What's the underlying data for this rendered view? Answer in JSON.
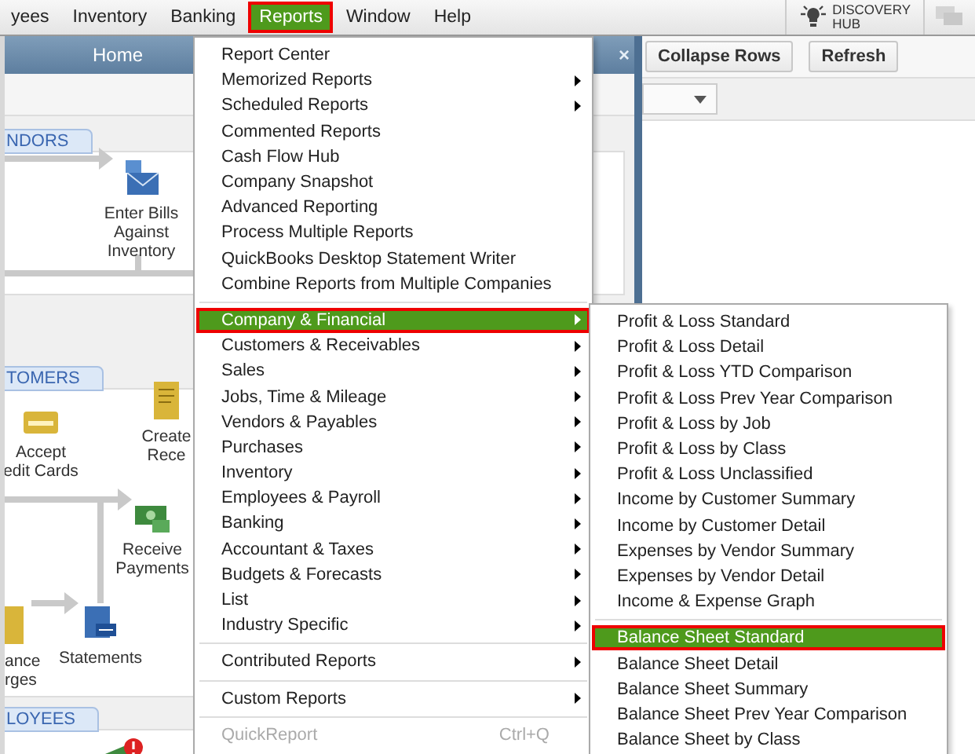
{
  "menubar": {
    "items": [
      {
        "label": "yees",
        "selected": false
      },
      {
        "label": "Inventory",
        "selected": false
      },
      {
        "label": "Banking",
        "selected": false
      },
      {
        "label": "Reports",
        "selected": true
      },
      {
        "label": "Window",
        "selected": false
      },
      {
        "label": "Help",
        "selected": false
      }
    ],
    "discovery_hub": {
      "line1": "DISCOVERY",
      "line2": "HUB"
    }
  },
  "home_window": {
    "title": "Home",
    "close": "×",
    "sections": [
      {
        "label": "NDORS"
      },
      {
        "label": "TOMERS"
      },
      {
        "label": "LOYEES"
      }
    ],
    "nodes": [
      {
        "lines": [
          "Enter Bills",
          "Against",
          "Inventory"
        ],
        "kind": "bills"
      },
      {
        "lines": [
          "Accept",
          "edit Cards"
        ],
        "kind": "card"
      },
      {
        "lines": [
          "Create",
          "Rece"
        ],
        "kind": "receipt"
      },
      {
        "lines": [
          "Receive",
          "Payments"
        ],
        "kind": "payment"
      },
      {
        "lines": [
          "ance",
          "rges"
        ],
        "kind": "charges"
      },
      {
        "lines": [
          "Statements"
        ],
        "kind": "statement"
      },
      {
        "kind": "paycheck"
      }
    ]
  },
  "report_toolbar": {
    "buttons": [
      "Collapse Rows",
      "Refresh"
    ]
  },
  "reports_menu": {
    "items": [
      {
        "label": "Report Center",
        "submenu": false,
        "selected": false,
        "disabled": false,
        "separator_before": false
      },
      {
        "label": "Memorized Reports",
        "submenu": true,
        "selected": false,
        "disabled": false,
        "separator_before": false
      },
      {
        "label": "Scheduled Reports",
        "submenu": true,
        "selected": false,
        "disabled": false,
        "separator_before": false
      },
      {
        "label": "Commented Reports",
        "submenu": false,
        "selected": false,
        "disabled": false,
        "separator_before": false
      },
      {
        "label": "Cash Flow Hub",
        "submenu": false,
        "selected": false,
        "disabled": false,
        "separator_before": false
      },
      {
        "label": "Company Snapshot",
        "submenu": false,
        "selected": false,
        "disabled": false,
        "separator_before": false
      },
      {
        "label": "Advanced Reporting",
        "submenu": false,
        "selected": false,
        "disabled": false,
        "separator_before": false
      },
      {
        "label": "Process Multiple Reports",
        "submenu": false,
        "selected": false,
        "disabled": false,
        "separator_before": false
      },
      {
        "label": "QuickBooks Desktop Statement Writer",
        "submenu": false,
        "selected": false,
        "disabled": false,
        "separator_before": false
      },
      {
        "label": "Combine Reports from Multiple Companies",
        "submenu": false,
        "selected": false,
        "disabled": false,
        "separator_before": false
      },
      {
        "label": "Company & Financial",
        "submenu": true,
        "selected": true,
        "disabled": false,
        "separator_before": true
      },
      {
        "label": "Customers & Receivables",
        "submenu": true,
        "selected": false,
        "disabled": false,
        "separator_before": false
      },
      {
        "label": "Sales",
        "submenu": true,
        "selected": false,
        "disabled": false,
        "separator_before": false
      },
      {
        "label": "Jobs, Time & Mileage",
        "submenu": true,
        "selected": false,
        "disabled": false,
        "separator_before": false
      },
      {
        "label": "Vendors & Payables",
        "submenu": true,
        "selected": false,
        "disabled": false,
        "separator_before": false
      },
      {
        "label": "Purchases",
        "submenu": true,
        "selected": false,
        "disabled": false,
        "separator_before": false
      },
      {
        "label": "Inventory",
        "submenu": true,
        "selected": false,
        "disabled": false,
        "separator_before": false
      },
      {
        "label": "Employees & Payroll",
        "submenu": true,
        "selected": false,
        "disabled": false,
        "separator_before": false
      },
      {
        "label": "Banking",
        "submenu": true,
        "selected": false,
        "disabled": false,
        "separator_before": false
      },
      {
        "label": "Accountant & Taxes",
        "submenu": true,
        "selected": false,
        "disabled": false,
        "separator_before": false
      },
      {
        "label": "Budgets & Forecasts",
        "submenu": true,
        "selected": false,
        "disabled": false,
        "separator_before": false
      },
      {
        "label": "List",
        "submenu": true,
        "selected": false,
        "disabled": false,
        "separator_before": false
      },
      {
        "label": "Industry Specific",
        "submenu": true,
        "selected": false,
        "disabled": false,
        "separator_before": false
      },
      {
        "label": "Contributed Reports",
        "submenu": true,
        "selected": false,
        "disabled": false,
        "separator_before": true
      },
      {
        "label": "Custom Reports",
        "submenu": true,
        "selected": false,
        "disabled": false,
        "separator_before": true
      },
      {
        "label": "QuickReport",
        "submenu": false,
        "selected": false,
        "disabled": true,
        "separator_before": true,
        "shortcut": "Ctrl+Q"
      }
    ]
  },
  "company_financial_menu": {
    "items": [
      {
        "label": "Profit & Loss Standard",
        "selected": false,
        "separator_before": false
      },
      {
        "label": "Profit & Loss Detail",
        "selected": false,
        "separator_before": false
      },
      {
        "label": "Profit & Loss YTD Comparison",
        "selected": false,
        "separator_before": false
      },
      {
        "label": "Profit & Loss Prev Year Comparison",
        "selected": false,
        "separator_before": false
      },
      {
        "label": "Profit & Loss by Job",
        "selected": false,
        "separator_before": false
      },
      {
        "label": "Profit & Loss by Class",
        "selected": false,
        "separator_before": false
      },
      {
        "label": "Profit & Loss Unclassified",
        "selected": false,
        "separator_before": false
      },
      {
        "label": "Income by Customer Summary",
        "selected": false,
        "separator_before": false
      },
      {
        "label": "Income by Customer Detail",
        "selected": false,
        "separator_before": false
      },
      {
        "label": "Expenses by Vendor Summary",
        "selected": false,
        "separator_before": false
      },
      {
        "label": "Expenses by Vendor Detail",
        "selected": false,
        "separator_before": false
      },
      {
        "label": "Income & Expense Graph",
        "selected": false,
        "separator_before": false
      },
      {
        "label": "Balance Sheet Standard",
        "selected": true,
        "separator_before": true
      },
      {
        "label": "Balance Sheet Detail",
        "selected": false,
        "separator_before": false
      },
      {
        "label": "Balance Sheet Summary",
        "selected": false,
        "separator_before": false
      },
      {
        "label": "Balance Sheet Prev Year Comparison",
        "selected": false,
        "separator_before": false
      },
      {
        "label": "Balance Sheet by Class",
        "selected": false,
        "separator_before": false
      }
    ]
  }
}
